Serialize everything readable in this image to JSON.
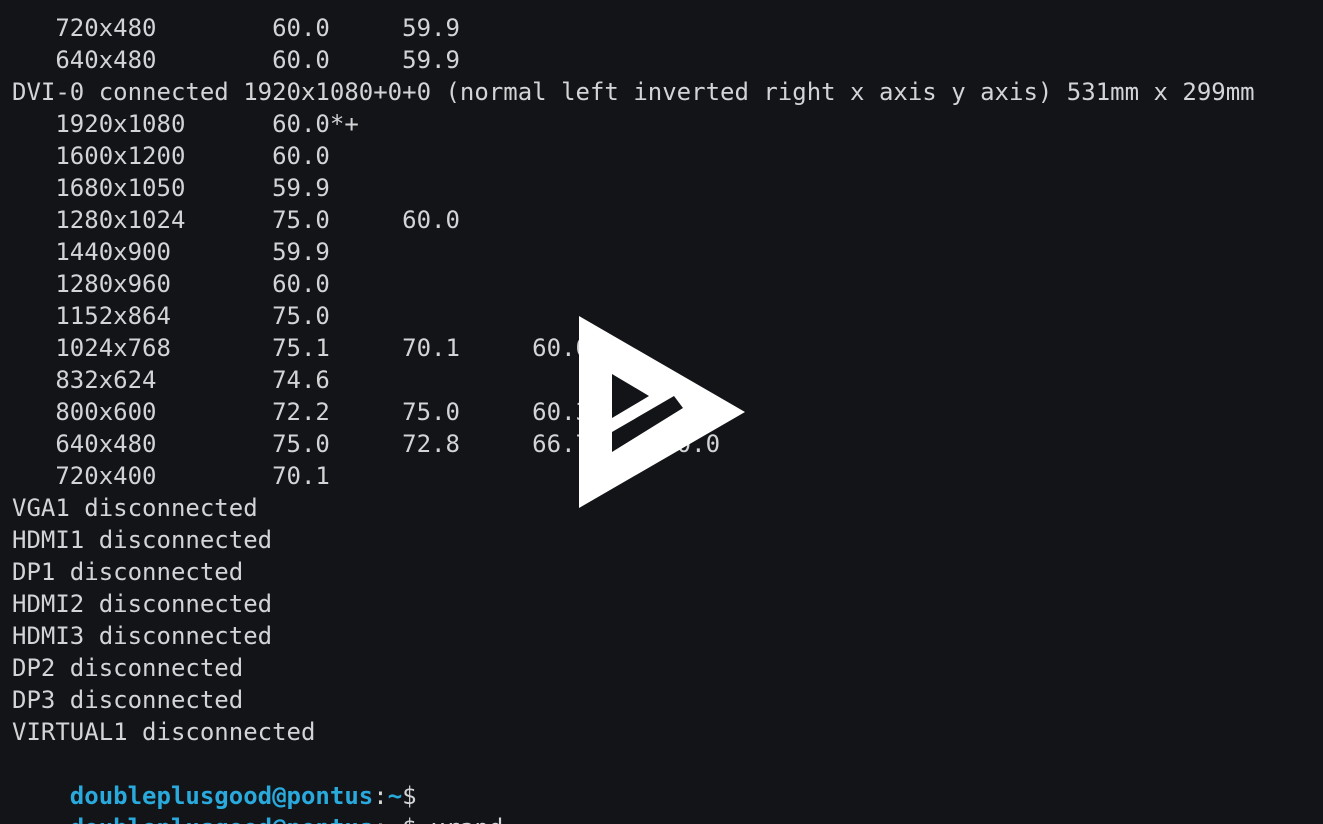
{
  "terminal": {
    "lines": [
      "   720x480        60.0     59.9  ",
      "   640x480        60.0     59.9  ",
      "DVI-0 connected 1920x1080+0+0 (normal left inverted right x axis y axis) 531mm x 299mm",
      "   1920x1080      60.0*+",
      "   1600x1200      60.0  ",
      "   1680x1050      59.9  ",
      "   1280x1024      75.0     60.0  ",
      "   1440x900       59.9  ",
      "   1280x960       60.0  ",
      "   1152x864       75.0  ",
      "   1024x768       75.1     70.1     60.0  ",
      "   832x624        74.6  ",
      "   800x600        72.2     75.0     60.3     56.2  ",
      "   640x480        75.0     72.8     66.7     60.0  ",
      "   720x400        70.1  ",
      "VGA1 disconnected",
      "HDMI1 disconnected",
      "DP1 disconnected",
      "HDMI2 disconnected",
      "HDMI3 disconnected",
      "DP2 disconnected",
      "DP3 disconnected",
      "VIRTUAL1 disconnected"
    ],
    "prompts": [
      {
        "user_host": "doubleplusgood@pontus",
        "sep": ":",
        "path": "~",
        "symbol": "$",
        "command": ""
      },
      {
        "user_host": "doubleplusgood@pontus",
        "sep": ":",
        "path": "~",
        "symbol": "$",
        "command": " xrand"
      }
    ]
  },
  "overlay": {
    "icon": "asciinema-play-icon",
    "color": "#ffffff"
  },
  "colors": {
    "background": "#131417",
    "text": "#d2d4d6",
    "prompt": "#29a9dc"
  }
}
